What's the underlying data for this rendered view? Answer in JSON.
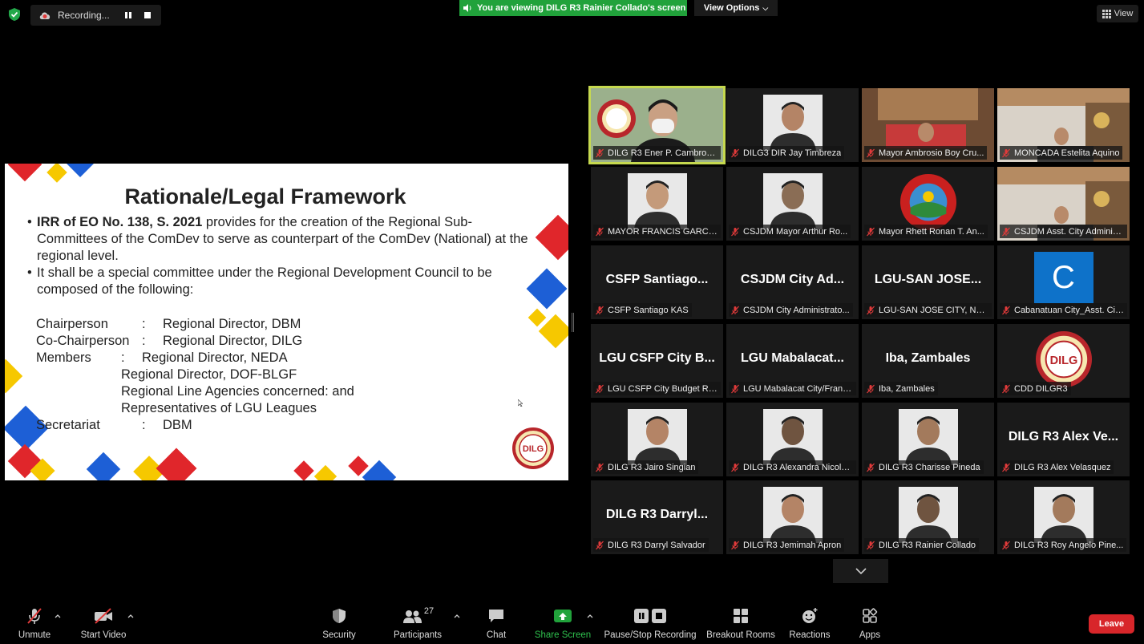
{
  "topbar": {
    "recording_label": "Recording...",
    "viewing_banner": "You are viewing DILG R3 Rainier Collado's screen",
    "view_options": "View Options",
    "view_label": "View"
  },
  "slide": {
    "title": "Rationale/Legal Framework",
    "bullet1_bold": "IRR of EO No. 138, S. 2021",
    "bullet1_rest": " provides for the creation of the Regional Sub-Committees of the ComDev to serve as counterpart of the ComDev (National) at the regional level.",
    "bullet2": "It shall be a special committee under the Regional Development Council to be composed of the following:",
    "chair_label": "Chairperson",
    "chair_colon": ":",
    "chair_value": "Regional Director, DBM",
    "cochair_label": "Co-Chairperson",
    "cochair_colon": ":",
    "cochair_value": "Regional Director, DILG",
    "members_label": "Members",
    "members_colon": ":",
    "members_values": [
      "Regional Director, NEDA",
      "Regional Director, DOF-BLGF",
      "Regional Line Agencies concerned: and",
      "Representatives of LGU Leagues"
    ],
    "sec_label": "Secretariat",
    "sec_colon": ":",
    "sec_value": "DBM",
    "logo_text": "DILG"
  },
  "gallery": [
    {
      "name": "DILG R3 Ener P. Cambronero...",
      "big": "",
      "kind": "video-dilg"
    },
    {
      "name": "DILG3 DIR Jay Timbreza",
      "big": "",
      "kind": "photo"
    },
    {
      "name": "Mayor Ambrosio Boy Cru...",
      "big": "",
      "kind": "video-room"
    },
    {
      "name": "MONCADA Estelita Aquino",
      "big": "",
      "kind": "video-office"
    },
    {
      "name": "MAYOR FRANCIS GARCIA...",
      "big": "",
      "kind": "photo"
    },
    {
      "name": "CSJDM Mayor Arthur Ro...",
      "big": "",
      "kind": "photo"
    },
    {
      "name": "Mayor Rhett Ronan T. An...",
      "big": "",
      "kind": "seal"
    },
    {
      "name": "CSJDM Asst. City Adminis...",
      "big": "",
      "kind": "video-office"
    },
    {
      "name": "CSFP Santiago KAS",
      "big": "CSFP Santiago...",
      "kind": "text"
    },
    {
      "name": "CSJDM City Administrato...",
      "big": "CSJDM City Ad...",
      "kind": "text"
    },
    {
      "name": "LGU-SAN JOSE CITY, NUE...",
      "big": "LGU-SAN JOSE...",
      "kind": "text"
    },
    {
      "name": "Cabanatuan City_Asst. Cit...",
      "big": "C",
      "kind": "letter"
    },
    {
      "name": "LGU CSFP City Budget Riz...",
      "big": "LGU CSFP City B...",
      "kind": "text"
    },
    {
      "name": "LGU Mabalacat City/Franc...",
      "big": "LGU Mabalacat...",
      "kind": "text"
    },
    {
      "name": "Iba, Zambales",
      "big": "Iba, Zambales",
      "kind": "text"
    },
    {
      "name": "CDD DILGR3",
      "big": "DILG",
      "kind": "dilg-logo"
    },
    {
      "name": "DILG R3 Jairo Singian",
      "big": "",
      "kind": "photo"
    },
    {
      "name": "DILG R3 Alexandra Nicole...",
      "big": "",
      "kind": "photo"
    },
    {
      "name": "DILG R3 Charisse Pineda",
      "big": "",
      "kind": "photo"
    },
    {
      "name": "DILG R3 Alex Velasquez",
      "big": "DILG R3 Alex Ve...",
      "kind": "text"
    },
    {
      "name": "DILG R3 Darryl Salvador",
      "big": "DILG R3 Darryl...",
      "kind": "text"
    },
    {
      "name": "DILG R3 Jemimah Apron",
      "big": "",
      "kind": "photo"
    },
    {
      "name": "DILG R3 Rainier Collado",
      "big": "",
      "kind": "photo"
    },
    {
      "name": "DILG R3 Roy Angelo Pine...",
      "big": "",
      "kind": "photo"
    }
  ],
  "toolbar": {
    "unmute": "Unmute",
    "start_video": "Start Video",
    "security": "Security",
    "participants": "Participants",
    "participants_count": "27",
    "chat": "Chat",
    "share_screen": "Share Screen",
    "recording": "Pause/Stop Recording",
    "breakout": "Breakout Rooms",
    "reactions": "Reactions",
    "apps": "Apps",
    "leave": "Leave"
  },
  "colors": {
    "accent_green": "#21a23b",
    "leave_red": "#d8262a",
    "active_speaker": "#c6d94f",
    "mute_red": "#e03a3a"
  }
}
